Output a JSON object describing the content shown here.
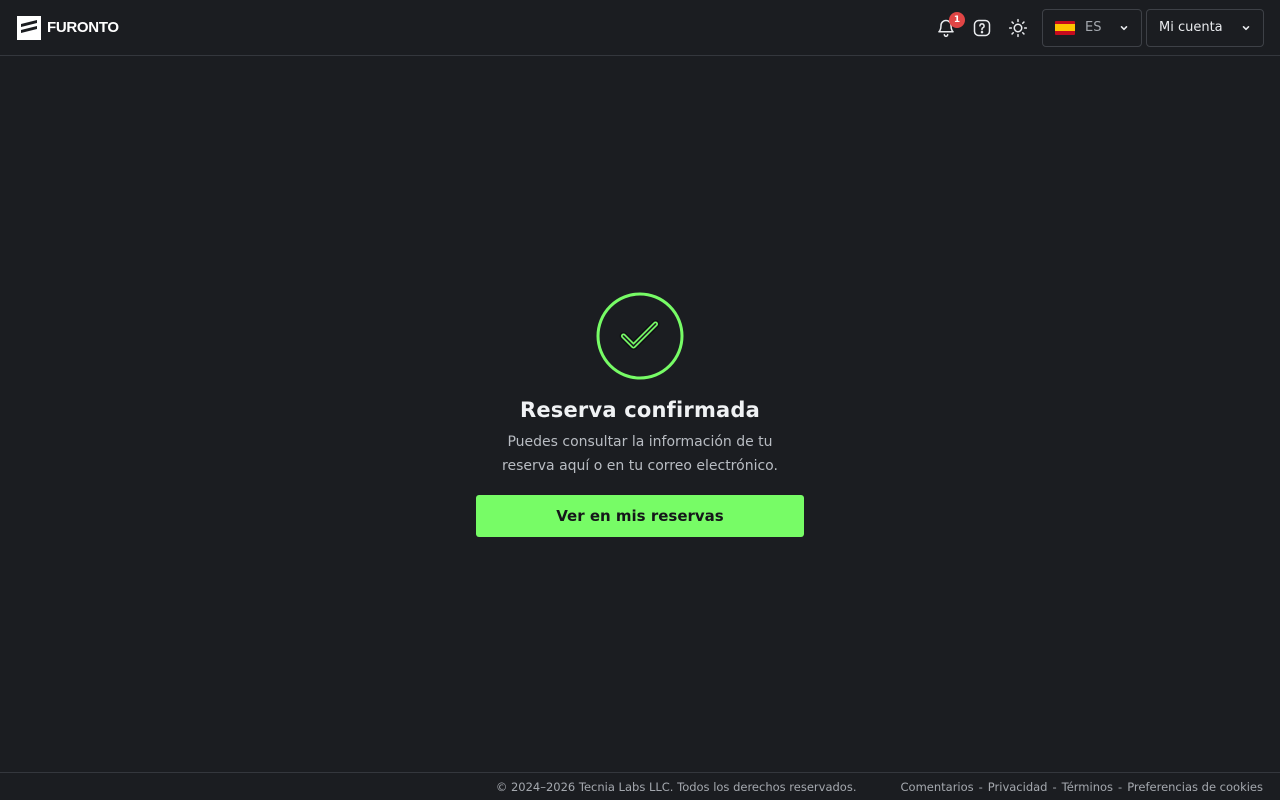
{
  "header": {
    "brand": "FURONTO",
    "notifications": {
      "count": "1",
      "icon": "bell-icon"
    },
    "help_icon": "help-icon",
    "theme_icon": "sun-icon",
    "language": {
      "code": "ES",
      "flag": "spain-flag-icon"
    },
    "account": {
      "label": "Mi cuenta"
    }
  },
  "confirmation": {
    "icon": "check-circle-icon",
    "title": "Reserva confirmada",
    "description": "Puedes consultar la información de tu reserva aquí o en tu correo electrónico.",
    "button_label": "Ver en mis reservas"
  },
  "footer": {
    "copyright": "© 2024–2026 Tecnia Labs LLC. Todos los derechos reservados.",
    "links": [
      "Comentarios",
      "Privacidad",
      "Términos",
      "Preferencias de cookies"
    ],
    "separator": "-"
  },
  "colors": {
    "background": "#1b1d21",
    "accent": "#77fc66",
    "badge": "#e04545",
    "border": "#34373d"
  }
}
